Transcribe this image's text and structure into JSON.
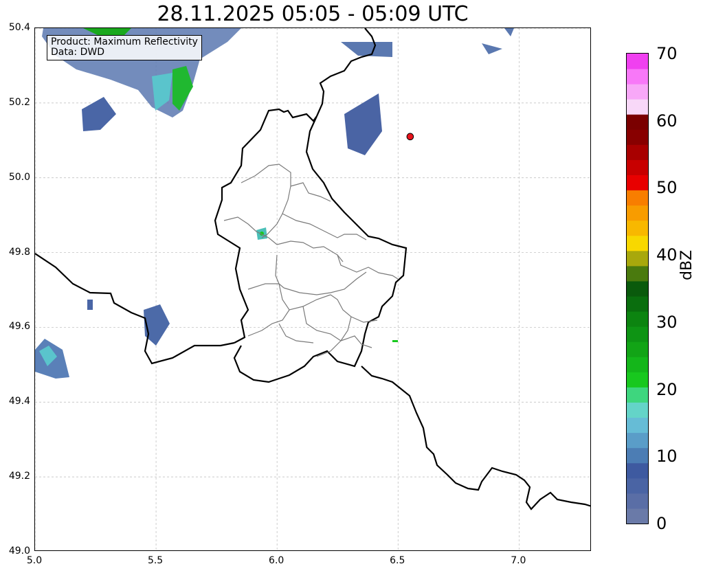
{
  "title": "28.11.2025 05:05 - 05:09 UTC",
  "info": {
    "product_line": "Product: Maximum Reflectivity",
    "data_line": "Data: DWD"
  },
  "map": {
    "lon_range": [
      5.0,
      7.3
    ],
    "lat_range": [
      49.0,
      50.4
    ],
    "x_ticks": [
      "5.0",
      "5.5",
      "6.0",
      "6.5",
      "7.0"
    ],
    "y_ticks": [
      "50.4",
      "50.2",
      "50.0",
      "49.8",
      "49.6",
      "49.4",
      "49.2",
      "49.0"
    ],
    "gridlines": "dashed",
    "marker": {
      "lon": 6.55,
      "lat": 50.11,
      "color": "#e8141c"
    }
  },
  "colorbar": {
    "label": "dBZ",
    "ticks": [
      "0",
      "10",
      "20",
      "30",
      "40",
      "50",
      "60",
      "70"
    ],
    "range": [
      0,
      70
    ],
    "colors": [
      "#6a7aa8",
      "#5a6ea6",
      "#4a64a4",
      "#3e5aa0",
      "#4c7db4",
      "#5a9dc8",
      "#66bcd6",
      "#64d4c8",
      "#3ed67e",
      "#18c81e",
      "#14b61a",
      "#12a416",
      "#0e9414",
      "#0c8410",
      "#0a6e0e",
      "#0a5a0c",
      "#4a7a0e",
      "#a8a80c",
      "#f8d800",
      "#f8b800",
      "#f89c00",
      "#f87e00",
      "#e80000",
      "#c80000",
      "#a80000",
      "#880000",
      "#7a0000",
      "#f8d8f8",
      "#f8a8f8",
      "#f878f8",
      "#f040f0"
    ]
  }
}
